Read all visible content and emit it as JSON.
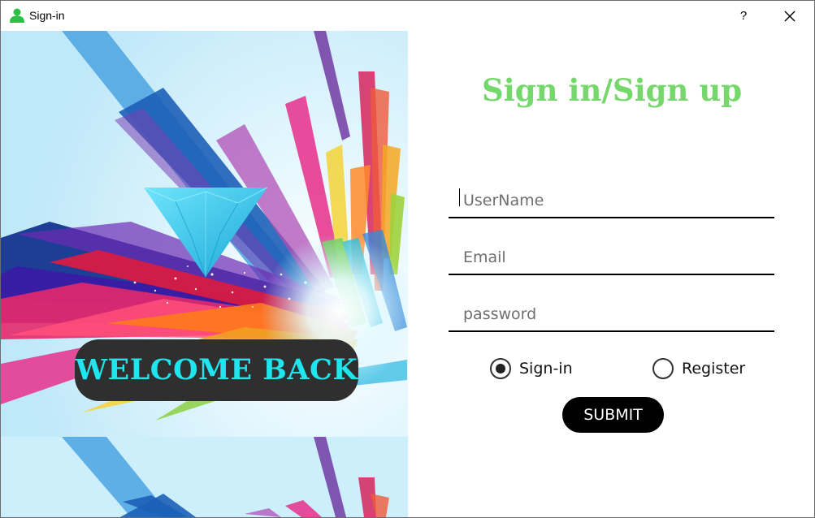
{
  "window": {
    "title": "Sign-in",
    "help_label": "?",
    "icons": {
      "app": "user-icon",
      "close": "close-icon"
    }
  },
  "banner": {
    "welcome_text": "WELCOME BACK"
  },
  "form": {
    "heading": "Sign in/Sign up",
    "username_placeholder": "UserName",
    "email_placeholder": "Email",
    "password_placeholder": "password",
    "mode_options": [
      {
        "label": "Sign-in",
        "selected": true
      },
      {
        "label": "Register",
        "selected": false
      }
    ],
    "submit_label": "SUBMIT"
  },
  "colors": {
    "heading": "#76d86c",
    "welcome_text": "#1fe6ee",
    "welcome_bg": "#2f2f2f",
    "submit_bg": "#000000",
    "app_icon": "#2fbf46"
  }
}
